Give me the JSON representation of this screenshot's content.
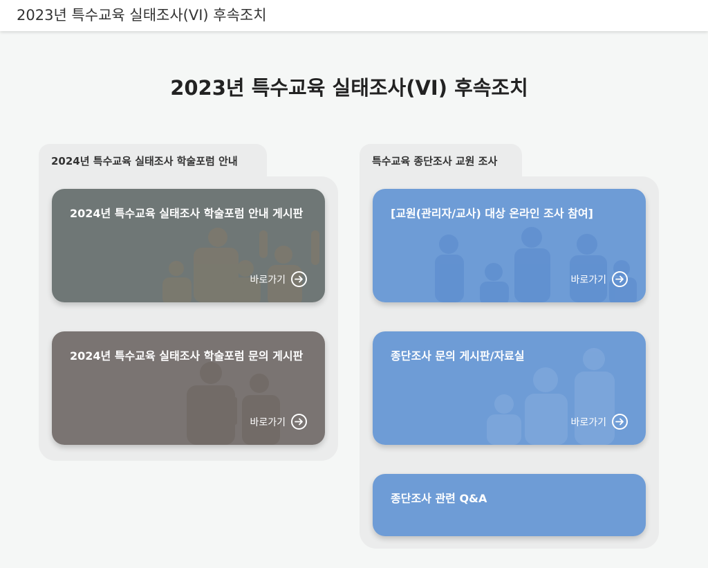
{
  "header": {
    "title": "2023년 특수교육 실태조사(VI) 후속조치"
  },
  "main": {
    "title": "2023년 특수교육 실태조사(VI) 후속조치"
  },
  "panels": [
    {
      "tab_label": "2024년 특수교육 실태조사 학술포럼 안내",
      "cards": [
        {
          "title": "2024년 특수교육 실태조사 학술포럼 안내 게시판",
          "link_label": "바로가기",
          "color": "#6f7776"
        },
        {
          "title": "2024년 특수교육 실태조사 학술포럼 문의 게시판",
          "link_label": "바로가기",
          "color": "#7a7472"
        }
      ]
    },
    {
      "tab_label": "특수교육 종단조사 교원 조사",
      "cards": [
        {
          "title": "[교원(관리자/교사) 대상 온라인 조사 참여]",
          "link_label": "바로가기",
          "color": "#6e9cd6"
        },
        {
          "title": "종단조사 문의 게시판/자료실",
          "link_label": "바로가기",
          "color": "#6e9cd6"
        },
        {
          "title": "종단조사 관련 Q&A",
          "color": "#6e9cd6"
        }
      ]
    }
  ],
  "icons": {
    "go": "arrow-right-circle-icon"
  }
}
